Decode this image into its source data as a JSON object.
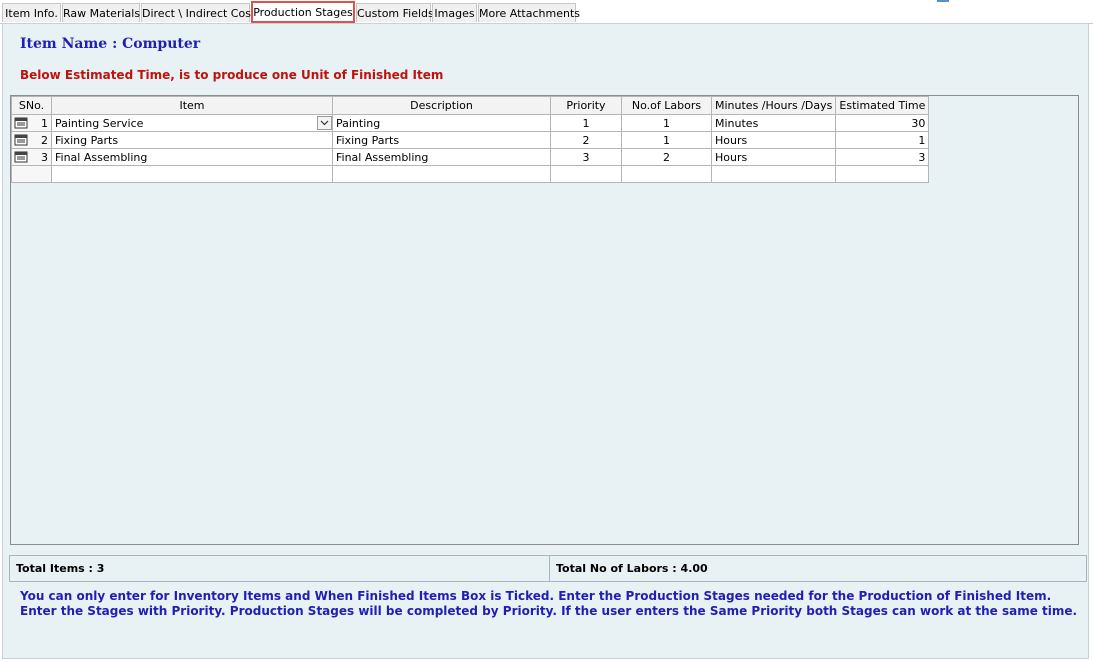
{
  "tabs": [
    {
      "label": "Item Info."
    },
    {
      "label": "Raw Materials"
    },
    {
      "label": "Direct \\ Indirect Cost"
    },
    {
      "label": "Production Stages",
      "active": true
    },
    {
      "label": "Custom Fields"
    },
    {
      "label": "Images"
    },
    {
      "label": "More Attachments"
    }
  ],
  "item_name": "Item Name : Computer",
  "estimate_note": "Below Estimated Time, is to produce one Unit of Finished Item",
  "grid": {
    "columns": [
      "SNo.",
      "Item",
      "Description",
      "Priority",
      "No.of Labors",
      "Minutes /Hours /Days",
      "Estimated Time"
    ],
    "rows": [
      {
        "sno": "1",
        "item": "Painting Service",
        "description": "Painting",
        "priority": "1",
        "labors": "1",
        "unit": "Minutes",
        "estimated": "30"
      },
      {
        "sno": "2",
        "item": "Fixing Parts",
        "description": "Fixing Parts",
        "priority": "2",
        "labors": "1",
        "unit": "Hours",
        "estimated": "1"
      },
      {
        "sno": "3",
        "item": "Final Assembling",
        "description": "Final Assembling",
        "priority": "3",
        "labors": "2",
        "unit": "Hours",
        "estimated": "3"
      }
    ]
  },
  "totals": {
    "items": "Total Items : 3",
    "labors": "Total No of Labors : 4.00"
  },
  "info_lines": [
    "You can only enter for Inventory Items and When Finished Items Box is Ticked. Enter the Production Stages needed for the Production of Finished Item.",
    "Enter the Stages with Priority. Production Stages will be completed by Priority. If the user enters the Same Priority both Stages can work at the same time."
  ],
  "colors": {
    "active_tab_border": "#d9534f",
    "heading_blue": "#1f1fb4",
    "note_red": "#c0120c",
    "panel_bg": "#e8f1f3"
  }
}
